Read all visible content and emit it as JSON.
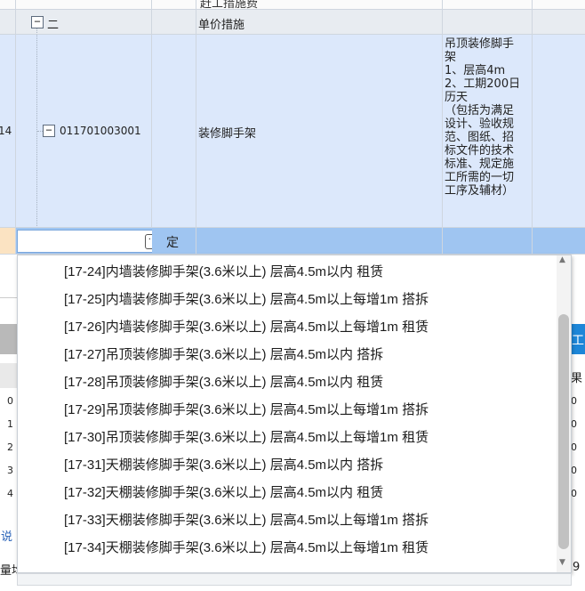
{
  "grid": {
    "top_row": {
      "title": "赶工措施费"
    },
    "group_row": {
      "number": "二",
      "name": "单价措施"
    },
    "item_row": {
      "row_number": "14",
      "code": "011701003001",
      "name": "装修脚手架",
      "description_lines": [
        "吊顶装修脚手",
        "架",
        "1、层高4m",
        "2、工期200日",
        "历天",
        "（包括为满足",
        "设计、验收规",
        "范、图纸、招",
        "标文件的技术",
        "标准、规定施",
        "工所需的一切",
        "工序及辅材）"
      ]
    },
    "edit_row": {
      "ellipsis_label": "···",
      "type_label": "定"
    }
  },
  "dropdown": {
    "items": [
      "[17-24]内墙装修脚手架(3.6米以上) 层高4.5m以内 租赁",
      "[17-25]内墙装修脚手架(3.6米以上) 层高4.5m以上每增1m 搭拆",
      "[17-26]内墙装修脚手架(3.6米以上) 层高4.5m以上每增1m 租赁",
      "[17-27]吊顶装修脚手架(3.6米以上) 层高4.5m以内 搭拆",
      "[17-28]吊顶装修脚手架(3.6米以上) 层高4.5m以内 租赁",
      "[17-29]吊顶装修脚手架(3.6米以上) 层高4.5m以上每增1m 搭拆",
      "[17-30]吊顶装修脚手架(3.6米以上) 层高4.5m以上每增1m 租赁",
      "[17-31]天棚装修脚手架(3.6米以上) 层高4.5m以内 搭拆",
      "[17-32]天棚装修脚手架(3.6米以上) 层高4.5m以内 租赁",
      "[17-33]天棚装修脚手架(3.6米以上) 层高4.5m以上每增1m 搭拆",
      "[17-34]天棚装修脚手架(3.6米以上) 层高4.5m以上每增1m 租赁"
    ],
    "scroll_thumb_fraction": 0.74
  },
  "background": {
    "left_row_numbers": [
      "0",
      "1",
      "2",
      "3",
      "4"
    ],
    "left_bottom_chars": [
      "说",
      "量均"
    ],
    "right_header_char": "工",
    "right_col_header": "果",
    "right_values": [
      "0",
      "0",
      "0",
      "0",
      "0"
    ],
    "right_bottom": "9"
  },
  "colors": {
    "selected_row": "#dce8fb",
    "edit_row": "#9fc5f1",
    "group_row": "#e8ecf1",
    "grid_line": "#cfd6df"
  }
}
